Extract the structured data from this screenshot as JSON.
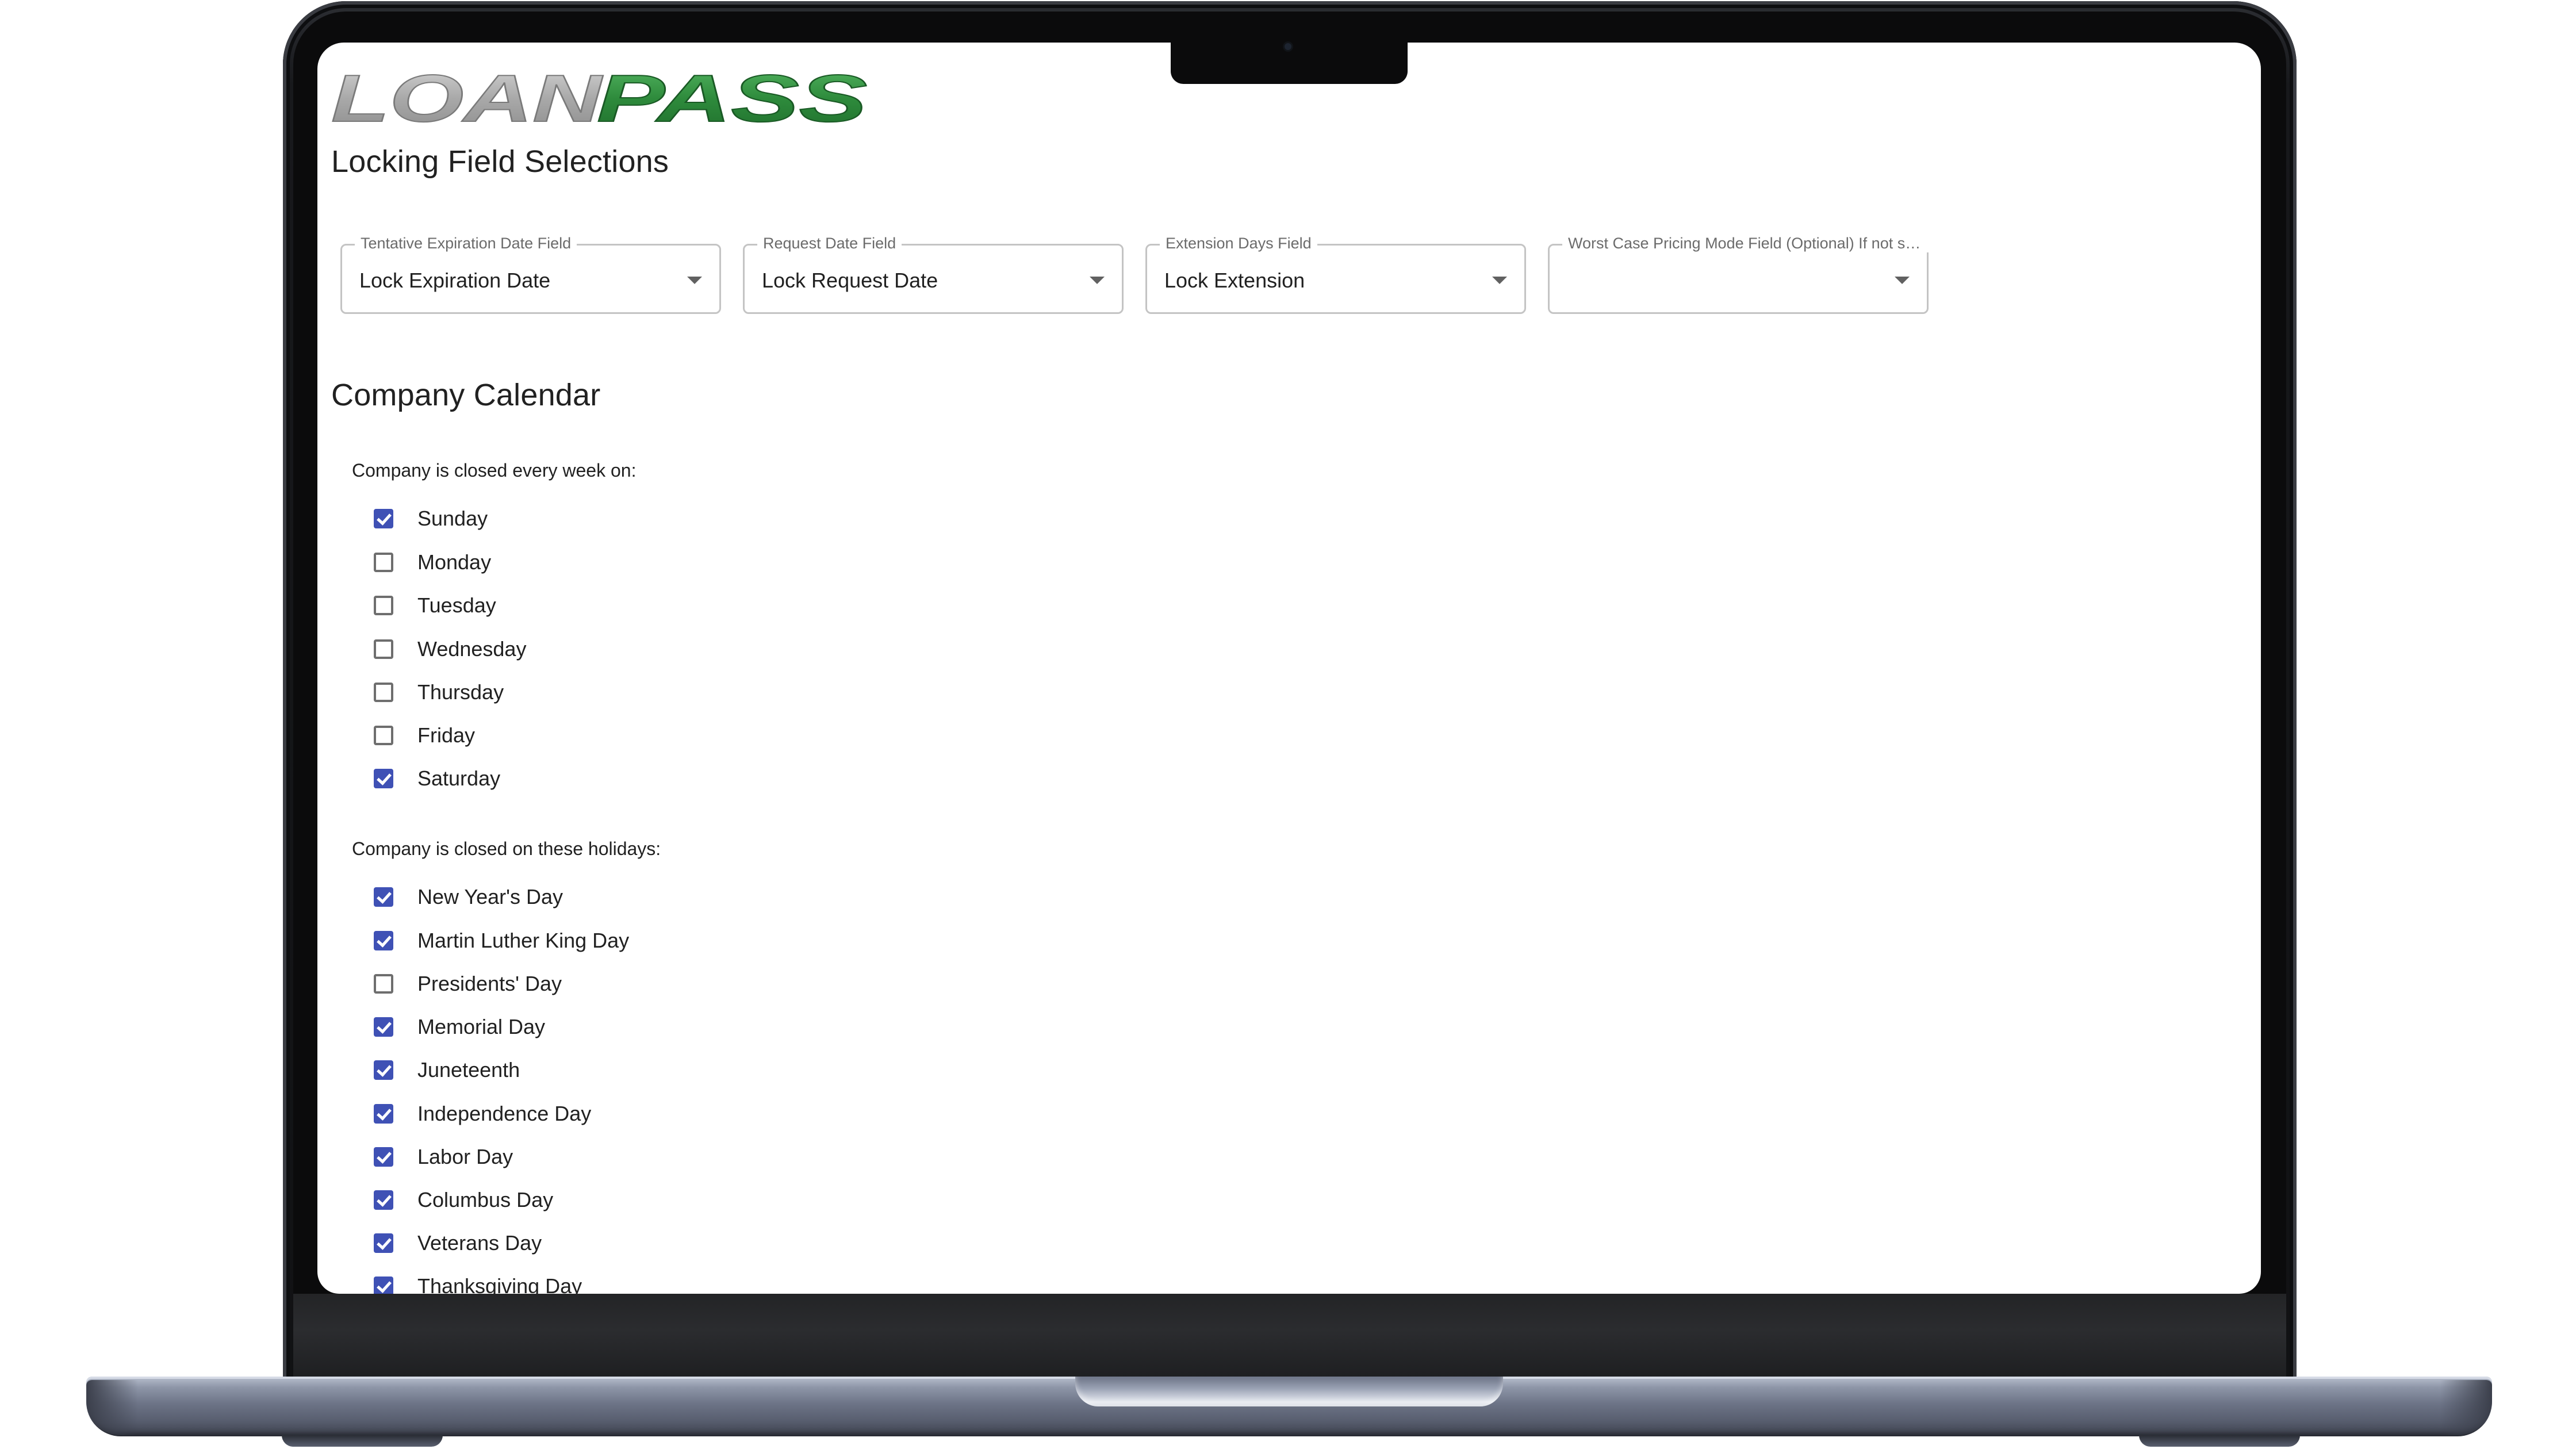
{
  "brand": {
    "logo_text": "LOANPASS",
    "logo_part_gray": "LOAN",
    "logo_part_green": "PASS",
    "gray_color": "#a9a9a9",
    "green_color": "#2e8b3c"
  },
  "locking": {
    "title": "Locking Field Selections",
    "fields": [
      {
        "label": "Tentative Expiration Date Field",
        "value": "Lock Expiration Date"
      },
      {
        "label": "Request Date Field",
        "value": "Lock Request Date"
      },
      {
        "label": "Extension Days Field",
        "value": "Lock Extension"
      },
      {
        "label": "Worst Case Pricing Mode Field (Optional) If not se...",
        "value": ""
      }
    ]
  },
  "calendar": {
    "title": "Company Calendar",
    "weekly_label": "Company is closed every week on:",
    "weekdays": [
      {
        "label": "Sunday",
        "checked": true
      },
      {
        "label": "Monday",
        "checked": false
      },
      {
        "label": "Tuesday",
        "checked": false
      },
      {
        "label": "Wednesday",
        "checked": false
      },
      {
        "label": "Thursday",
        "checked": false
      },
      {
        "label": "Friday",
        "checked": false
      },
      {
        "label": "Saturday",
        "checked": true
      }
    ],
    "holiday_label": "Company is closed on these holidays:",
    "holidays": [
      {
        "label": "New Year's Day",
        "checked": true
      },
      {
        "label": "Martin Luther King Day",
        "checked": true
      },
      {
        "label": "Presidents' Day",
        "checked": false
      },
      {
        "label": "Memorial Day",
        "checked": true
      },
      {
        "label": "Juneteenth",
        "checked": true
      },
      {
        "label": "Independence Day",
        "checked": true
      },
      {
        "label": "Labor Day",
        "checked": true
      },
      {
        "label": "Columbus Day",
        "checked": true
      },
      {
        "label": "Veterans Day",
        "checked": true
      },
      {
        "label": "Thanksgiving Day",
        "checked": true
      }
    ]
  },
  "colors": {
    "checkbox_checked": "#3f51b5",
    "checkbox_unchecked_border": "#6e6e6e",
    "text": "#212121",
    "field_border": "#c4c4c4"
  }
}
